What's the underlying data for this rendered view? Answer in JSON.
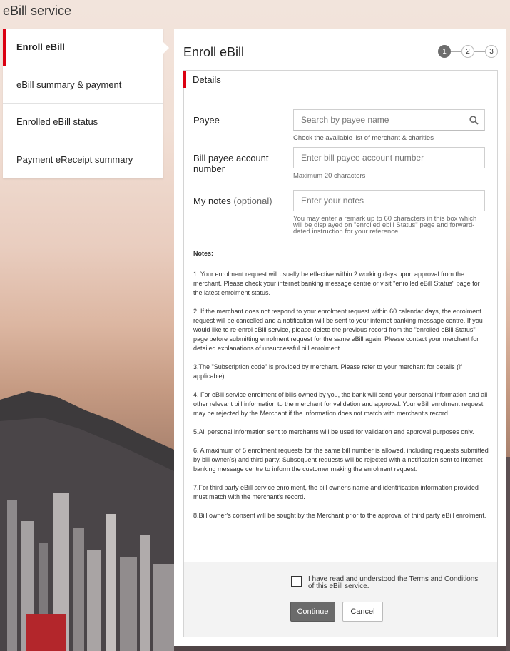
{
  "page": {
    "title": "eBill service"
  },
  "sidebar": {
    "items": [
      {
        "label": "Enroll eBill"
      },
      {
        "label": "eBill summary & payment"
      },
      {
        "label": "Enrolled eBill status"
      },
      {
        "label": "Payment eReceipt summary"
      }
    ],
    "active_index": 0
  },
  "main": {
    "title": "Enroll eBill",
    "steps": [
      "1",
      "2",
      "3"
    ],
    "current_step": 1
  },
  "details": {
    "header": "Details",
    "payee": {
      "label": "Payee",
      "placeholder": "Search by payee name",
      "link": "Check the available list of merchant & charities"
    },
    "account": {
      "label": "Bill payee account number",
      "placeholder": "Enter bill payee account number",
      "hint": "Maximum 20 characters"
    },
    "notes_field": {
      "label": "My notes",
      "optional": "(optional)",
      "placeholder": "Enter your notes",
      "hint": "You may enter a remark up to 60 characters in this box which will be displayed on \"enrolled ebill Status\" page and forward-dated instruction for your reference."
    }
  },
  "notes": {
    "title": "Notes:",
    "items": [
      "1. Your enrolment request will usually be effective within 2 working days upon approval from the merchant. Please check your internet banking message centre or visit \"enrolled eBill Status\" page for the latest enrolment status.",
      "2. If the merchant does not respond to your enrolment request within 60 calendar days, the enrolment request will be cancelled and a notification will be sent to your internet banking message centre. If you would like to re-enrol eBill service, please delete the previous record from the \"enrolled eBill Status\" page before submitting enrolment request for the same eBill again. Please contact your merchant for detailed explanations of unsuccessful bill enrolment.",
      "3.The \"Subscription code\" is provided by merchant. Please refer to your merchant for details (if applicable).",
      "4. For eBill service enrolment of bills owned by you, the bank will send your personal information and all other relevant bill information to the merchant for validation and approval. Your eBill enrolment request may be rejected by the Merchant if the information does not match with merchant's record.",
      "5.All personal information sent to merchants will be used for validation and approval purposes only.",
      "6. A maximum of 5 enrolment requests for the same bill number is allowed, including requests submitted by bill owner(s) and third party. Subsequent requests will be rejected with a notification sent to internet banking message centre to inform the customer making the enrolment request.",
      "7.For third party eBill service enrolment, the bill owner's name and identification information provided must match with the merchant's record.",
      "8.Bill owner's consent will be sought by the Merchant prior to the approval of third party eBill enrolment."
    ]
  },
  "footer": {
    "consent_prefix": "I have read and understood the ",
    "consent_link": "Terms and Conditions ",
    "consent_suffix": "of this eBill service.",
    "continue_label": "Continue",
    "cancel_label": "Cancel"
  },
  "colors": {
    "accent": "#db0011",
    "primary_button": "#6b6b6b"
  }
}
